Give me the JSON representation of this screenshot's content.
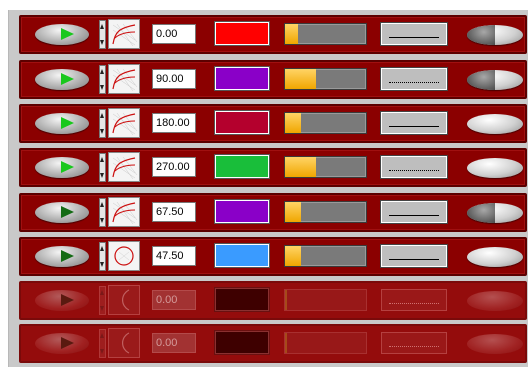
{
  "rows": [
    {
      "play_style": "bright",
      "curve_icon": "sine-curve-icon",
      "value": "0.00",
      "color": "#ff0000",
      "slider_fraction": 0.16,
      "line_style": "solid",
      "toggle_state": "half",
      "enabled": true
    },
    {
      "play_style": "bright",
      "curve_icon": "sine-curve-icon",
      "value": "90.00",
      "color": "#8a00c8",
      "slider_fraction": 0.38,
      "line_style": "dotted",
      "toggle_state": "half",
      "enabled": true
    },
    {
      "play_style": "bright",
      "curve_icon": "sine-curve-icon",
      "value": "180.00",
      "color": "#b4002d",
      "slider_fraction": 0.2,
      "line_style": "solid",
      "toggle_state": "full",
      "enabled": true
    },
    {
      "play_style": "bright",
      "curve_icon": "sine-curve-icon",
      "value": "270.00",
      "color": "#19be3a",
      "slider_fraction": 0.38,
      "line_style": "dotted",
      "toggle_state": "full",
      "enabled": true
    },
    {
      "play_style": "dark",
      "curve_icon": "sine-curve-icon",
      "value": "67.50",
      "color": "#8a00c8",
      "slider_fraction": 0.2,
      "line_style": "solid",
      "toggle_state": "half",
      "enabled": true
    },
    {
      "play_style": "dark",
      "curve_icon": "circle-icon",
      "value": "47.50",
      "color": "#3a9bff",
      "slider_fraction": 0.2,
      "line_style": "solid",
      "toggle_state": "full",
      "enabled": true
    },
    {
      "play_style": "dark",
      "curve_icon": "arc-icon",
      "value": "0.00",
      "color": "#3e0000",
      "slider_fraction": 0.02,
      "line_style": "dotted",
      "toggle_state": "full",
      "enabled": false
    },
    {
      "play_style": "dark",
      "curve_icon": "arc-icon",
      "value": "0.00",
      "color": "#3e0000",
      "slider_fraction": 0.02,
      "line_style": "dotted",
      "toggle_state": "full",
      "enabled": false
    }
  ]
}
